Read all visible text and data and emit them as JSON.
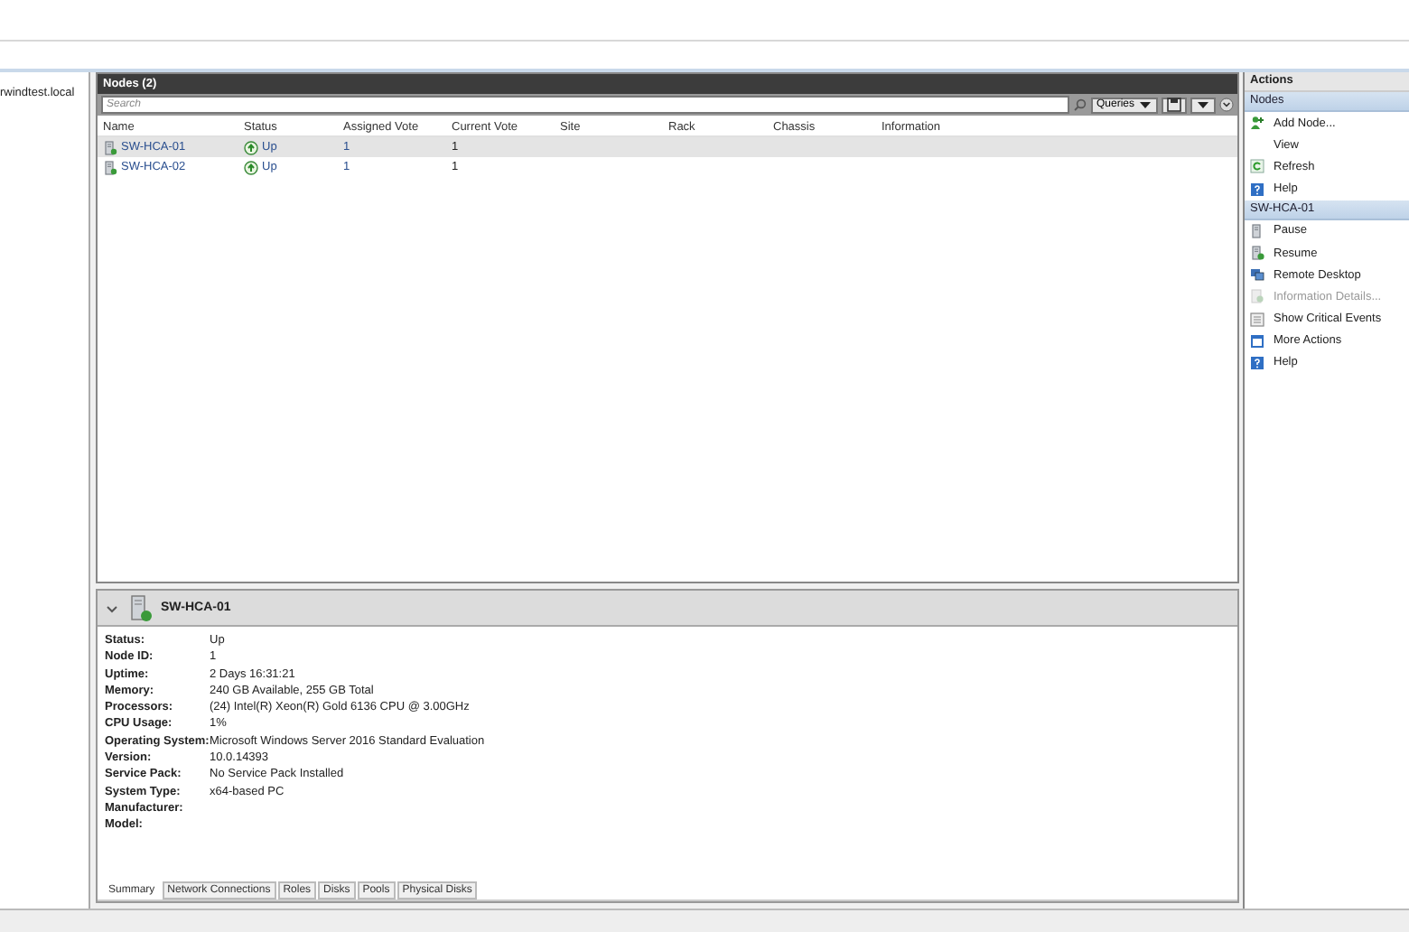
{
  "navigation": {
    "items": [
      {
        "label": "rwindtest.local"
      }
    ]
  },
  "nodes_panel": {
    "title": "Nodes (2)",
    "search": {
      "placeholder": "Search"
    },
    "queries": "Queries",
    "columns": [
      "Name",
      "Status",
      "Assigned Vote",
      "Current Vote",
      "Site",
      "Rack",
      "Chassis",
      "Information"
    ],
    "rows": [
      {
        "name": "SW-HCA-01",
        "status": "Up",
        "assigned_vote": "1",
        "current_vote": "1",
        "selected": true
      },
      {
        "name": "SW-HCA-02",
        "status": "Up",
        "assigned_vote": "1",
        "current_vote": "1",
        "selected": false
      }
    ]
  },
  "details": {
    "title": "SW-HCA-01",
    "expanded": true,
    "properties": [
      {
        "label": "Status:",
        "value": "Up"
      },
      {
        "label": "Node ID:",
        "value": "1"
      },
      {
        "label": "Uptime:",
        "value": "2 Days 16:31:21"
      },
      {
        "label": "Memory:",
        "value": "240 GB Available, 255 GB Total"
      },
      {
        "label": "Processors:",
        "value": "(24) Intel(R) Xeon(R) Gold 6136 CPU @ 3.00GHz"
      },
      {
        "label": "CPU Usage:",
        "value": "1%"
      },
      {
        "label": "Operating System:",
        "value": "Microsoft Windows Server 2016 Standard Evaluation"
      },
      {
        "label": "Version:",
        "value": "10.0.14393"
      },
      {
        "label": "Service Pack:",
        "value": "No Service Pack Installed"
      },
      {
        "label": "System Type:",
        "value": "x64-based PC"
      },
      {
        "label": "Manufacturer:"
      },
      {
        "label": "Model:"
      }
    ],
    "tabs": [
      {
        "label": "Summary",
        "selected": true
      },
      {
        "label": "Network Connections",
        "selected": false
      },
      {
        "label": "Roles",
        "selected": false
      },
      {
        "label": "Disks",
        "selected": false
      },
      {
        "label": "Pools",
        "selected": false
      },
      {
        "label": "Physical Disks",
        "selected": false
      }
    ]
  },
  "actions": {
    "title": "Actions",
    "sections": [
      {
        "title": "Nodes",
        "items": [
          {
            "label": "Add Node...",
            "kind": "add",
            "disabled": false
          },
          {
            "label": "View",
            "kind": "plain",
            "disabled": false
          },
          {
            "label": "Refresh",
            "kind": "refresh",
            "disabled": false
          },
          {
            "label": "Help",
            "kind": "help",
            "disabled": false
          }
        ]
      },
      {
        "title": "SW-HCA-01",
        "items": [
          {
            "label": "Pause",
            "kind": "pause",
            "disabled": false
          },
          {
            "label": "Resume",
            "kind": "resume",
            "disabled": false
          },
          {
            "label": "Remote Desktop",
            "kind": "remote",
            "disabled": false
          },
          {
            "label": "Information Details...",
            "kind": "info",
            "disabled": true
          },
          {
            "label": "Show Critical Events",
            "kind": "events",
            "disabled": false
          },
          {
            "label": "More Actions",
            "kind": "more",
            "disabled": false
          },
          {
            "label": "Help",
            "kind": "help",
            "disabled": false
          }
        ]
      }
    ]
  }
}
